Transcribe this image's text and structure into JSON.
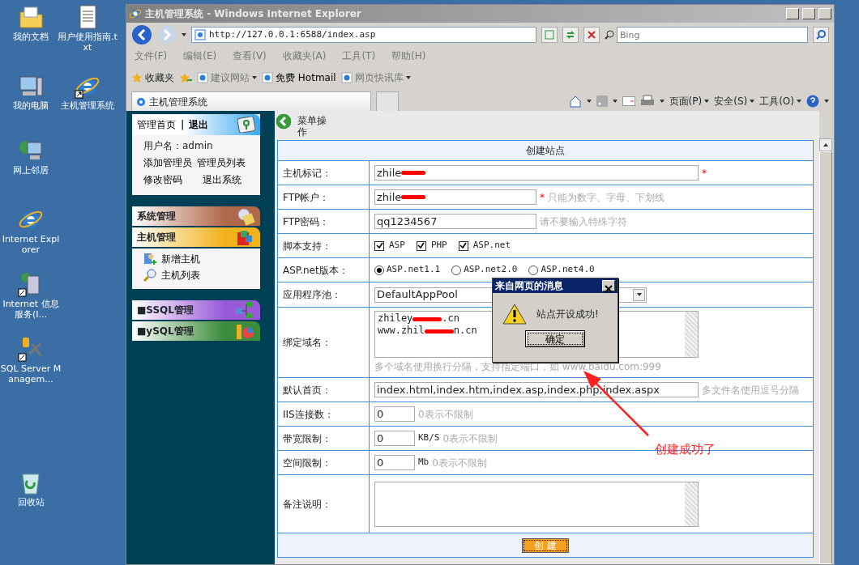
{
  "desktop_icons": [
    {
      "label": "我的文档",
      "kind": "folder"
    },
    {
      "label": "用户使用指南.txt",
      "kind": "textfile"
    },
    {
      "label": "我的电脑",
      "kind": "computer"
    },
    {
      "label": "主机管理系统",
      "kind": "ie_shortcut"
    },
    {
      "label": "网上邻居",
      "kind": "network"
    },
    {
      "label": "Internet Explorer",
      "kind": "ie"
    },
    {
      "label": "Internet 信息服务(I...",
      "kind": "iis"
    },
    {
      "label": "SQL Server Managem...",
      "kind": "sql"
    },
    {
      "label": "回收站",
      "kind": "recycle"
    }
  ],
  "window": {
    "title": "主机管理系统 - Windows Internet Explorer",
    "address": "http://127.0.0.1:6588/index.asp",
    "search_placeholder": "Bing",
    "menu": [
      "文件(F)",
      "编辑(E)",
      "查看(V)",
      "收藏夹(A)",
      "工具(T)",
      "帮助(H)"
    ],
    "favorites_label": "收藏夹",
    "favorite_links": [
      {
        "label": "建议网站",
        "dropdown": true
      },
      {
        "label": "免费 Hotmail",
        "dropdown": false
      },
      {
        "label": "网页快讯库",
        "dropdown": true
      }
    ],
    "tab": "主机管理系统",
    "commands": [
      "页面(P)",
      "安全(S)",
      "工具(O)"
    ]
  },
  "sidebar": {
    "home": "管理首页",
    "separator": "|",
    "logout": "退出",
    "user": "用户名：admin",
    "links": [
      "添加管理员",
      "管理员列表",
      "修改密码",
      "退出系统"
    ],
    "groups": [
      [
        {
          "title": "系统管理",
          "color": "#b0684a"
        },
        {
          "title": "主机管理",
          "color": "#f2b21c",
          "items": [
            {
              "label": "新增主机",
              "kind": "add"
            },
            {
              "label": "主机列表",
              "kind": "search"
            }
          ]
        }
      ],
      [
        {
          "title": "■SSQL管理",
          "color": "#9a5ad8"
        },
        {
          "title": "■ySQL管理",
          "color": "#3c8c3c"
        }
      ]
    ]
  },
  "page": {
    "menu_title": "菜单操作",
    "form_title": "创建站点",
    "rows": [
      {
        "label": "主机标记：",
        "kind": "long_text",
        "value": "zhile",
        "redacted": true,
        "required": "*"
      },
      {
        "label": "FTP帐户：",
        "kind": "text",
        "value": "zhile",
        "redacted": true,
        "required": "*",
        "hint": "只能为数字、字母、下划线"
      },
      {
        "label": "FTP密码：",
        "kind": "text",
        "value": "qq1234567",
        "redacted": false,
        "hint": "请不要输入特殊字符"
      },
      {
        "label": "脚本支持：",
        "kind": "checks",
        "options": [
          {
            "label": "ASP",
            "checked": true
          },
          {
            "label": "PHP",
            "checked": true
          },
          {
            "label": "ASP.net",
            "checked": true
          }
        ]
      },
      {
        "label": "ASP.net版本：",
        "kind": "radios",
        "options": [
          {
            "label": "ASP.net1.1",
            "selected": true
          },
          {
            "label": "ASP.net2.0",
            "selected": false
          },
          {
            "label": "ASP.net4.0",
            "selected": false
          }
        ]
      },
      {
        "label": "应用程序池：",
        "kind": "select",
        "value": "DefaultAppPool"
      },
      {
        "label": "绑定域名：",
        "kind": "domains",
        "lines": [
          [
            "zhiley",
            ".cn"
          ],
          [
            "www.zhil",
            "n.cn"
          ]
        ],
        "hint": "多个域名使用换行分隔，支持指定端口，如 www.baidu.com:999"
      },
      {
        "label": "默认首页：",
        "kind": "long_text",
        "value": "index.html,index.htm,index.asp,index.php,index.aspx",
        "redacted": false,
        "hint": "多文件名使用逗号分隔"
      },
      {
        "label": "IIS连接数：",
        "kind": "number",
        "value": "0",
        "hint": "0表示不限制"
      },
      {
        "label": "带宽限制：",
        "kind": "number",
        "value": "0",
        "unit": "KB/S",
        "hint": "0表示不限制"
      },
      {
        "label": "空间限制：",
        "kind": "number",
        "value": "0",
        "unit": "Mb",
        "hint": "0表示不限制"
      },
      {
        "label": "备注说明：",
        "kind": "memo"
      }
    ],
    "submit": "创 建"
  },
  "dialog": {
    "title": "来自网页的消息",
    "message": "站点开设成功!",
    "button": "确定"
  },
  "annotation": "创建成功了"
}
